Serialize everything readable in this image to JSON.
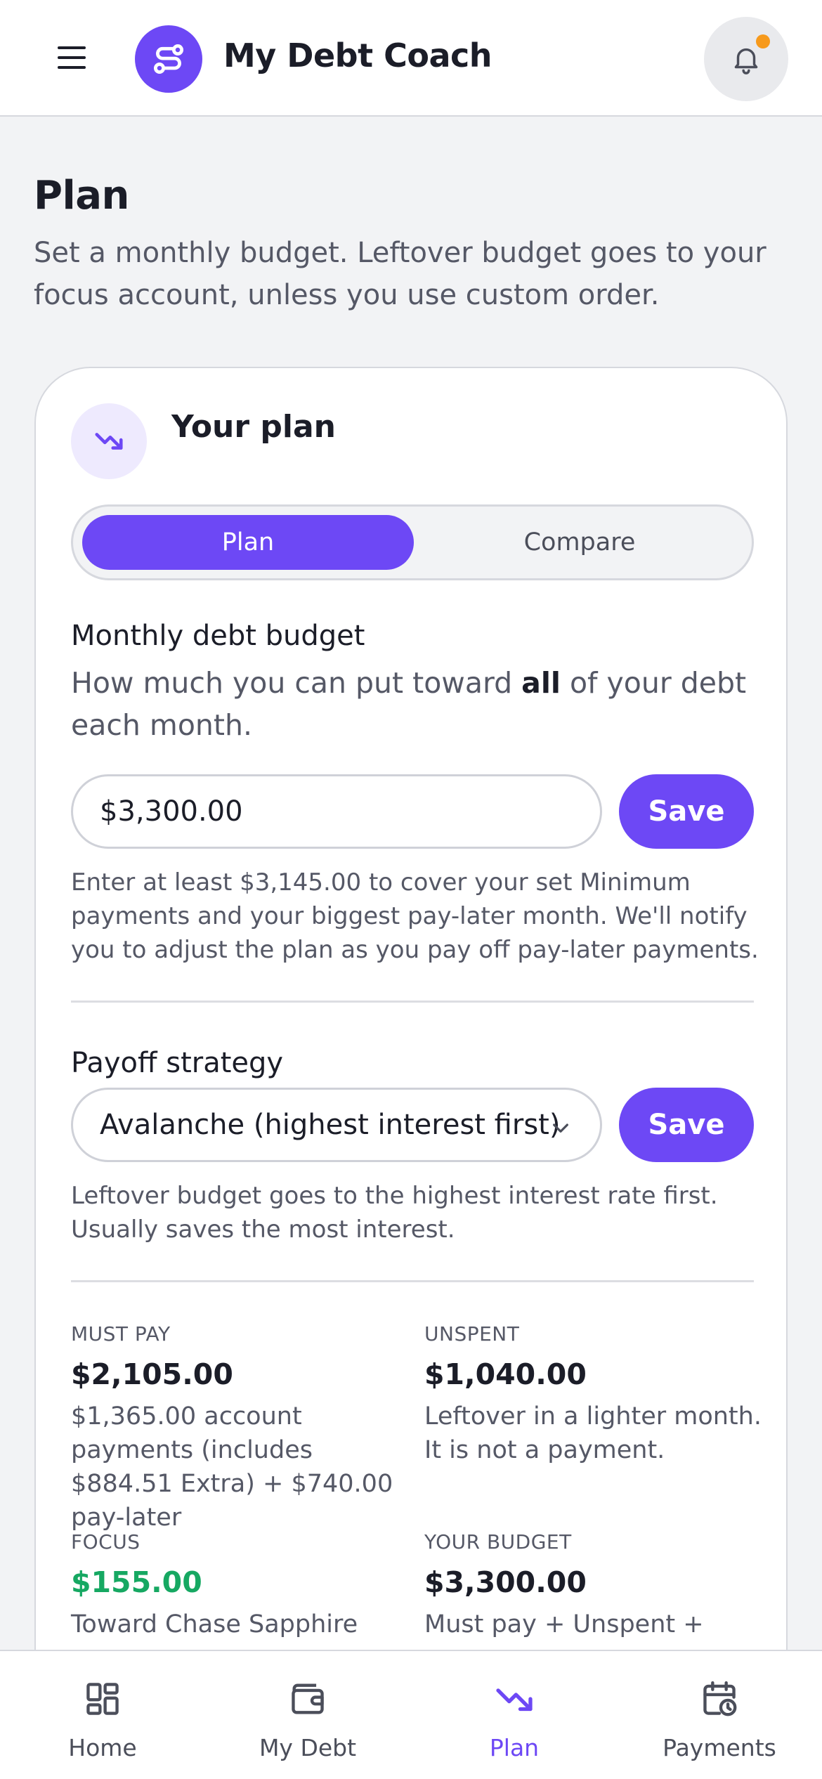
{
  "header": {
    "title": "My Debt Coach",
    "icons": {
      "menu": "hamburger-icon",
      "logo": "route-icon",
      "notifications": "bell-icon"
    },
    "has_notification_dot": true
  },
  "intro": {
    "title": "Plan",
    "subtitle": "Set a monthly budget. Leftover budget goes to your focus account, unless you use custom order."
  },
  "plan_card": {
    "title": "Your plan",
    "icon": "trending-down-icon",
    "tabs": [
      {
        "label": "Plan",
        "active": true
      },
      {
        "label": "Compare",
        "active": false
      }
    ],
    "budget": {
      "label": "Monthly debt budget",
      "help_before": "How much you can put toward ",
      "help_bold": "all",
      "help_after": " of your debt each month.",
      "value": "$3,300.00",
      "save_label": "Save",
      "note": "Enter at least $3,145.00 to cover your set Minimum payments and your biggest pay-later month. We'll notify you to adjust the plan as you pay off pay-later payments."
    },
    "strategy": {
      "label": "Payoff strategy",
      "selected": "Avalanche (highest interest first)",
      "save_label": "Save",
      "note": "Leftover budget goes to the highest interest rate first. Usually saves the most interest."
    },
    "summary": {
      "must_pay": {
        "label": "MUST PAY",
        "value": "$2,105.00",
        "desc": "$1,365.00 account payments (includes $884.51 Extra) + $740.00 pay-later"
      },
      "unspent": {
        "label": "UNSPENT",
        "value": "$1,040.00",
        "desc": "Leftover in a lighter month. It is not a payment."
      },
      "focus": {
        "label": "FOCUS",
        "value": "$155.00",
        "desc": "Toward Chase Sapphire"
      },
      "your_budget": {
        "label": "YOUR BUDGET",
        "value": "$3,300.00",
        "desc": "Must pay + Unspent +"
      }
    }
  },
  "colors": {
    "accent": "#6d48f5",
    "focus_green": "#16a862",
    "notification_dot": "#f79a1c"
  },
  "bottom_nav": [
    {
      "label": "Home",
      "icon": "grid-icon",
      "active": false
    },
    {
      "label": "My Debt",
      "icon": "wallet-icon",
      "active": false
    },
    {
      "label": "Plan",
      "icon": "trending-down-icon",
      "active": true
    },
    {
      "label": "Payments",
      "icon": "calendar-clock-icon",
      "active": false
    }
  ]
}
